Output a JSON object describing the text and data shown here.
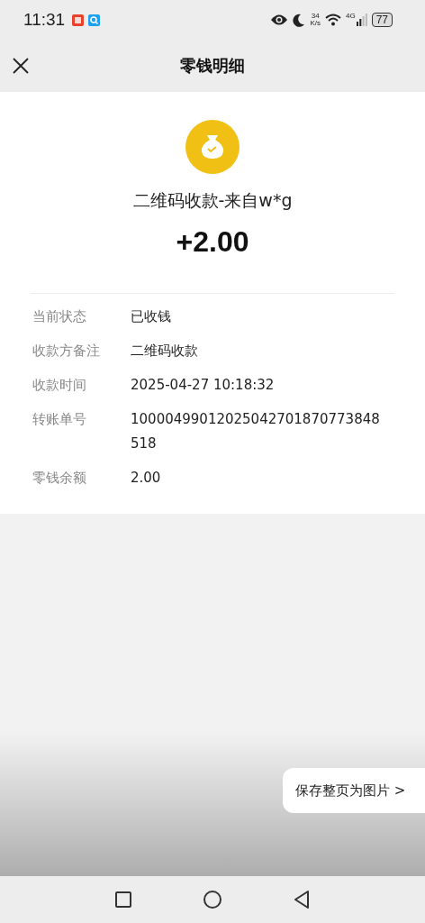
{
  "status_bar": {
    "time": "11:31",
    "net_speed_value": "34",
    "net_speed_unit": "K/s",
    "network_type": "4G",
    "battery": "77"
  },
  "header": {
    "title": "零钱明细"
  },
  "summary": {
    "title": "二维码收款-来自w*g",
    "amount": "+2.00"
  },
  "details": [
    {
      "label": "当前状态",
      "value": "已收钱"
    },
    {
      "label": "收款方备注",
      "value": "二维码收款"
    },
    {
      "label": "收款时间",
      "value": "2025-04-27 10:18:32"
    },
    {
      "label": "转账单号",
      "value": "10000499012025042701870773848518"
    },
    {
      "label": "零钱余额",
      "value": "2.00"
    }
  ],
  "save_button": {
    "label": "保存整页为图片 >"
  }
}
